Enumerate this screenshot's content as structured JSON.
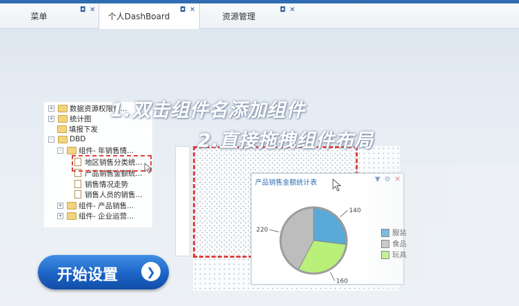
{
  "tabs": [
    {
      "label": "菜单",
      "active": false
    },
    {
      "label": "个人DashBoard",
      "active": true
    },
    {
      "label": "资源管理",
      "active": false
    }
  ],
  "tab_controls": {
    "restore": "◘",
    "close": "✕"
  },
  "tree": {
    "items": [
      {
        "label": "数据资源权限管...",
        "level": 0,
        "expander": "+"
      },
      {
        "label": "统计图",
        "level": 0,
        "expander": "+"
      },
      {
        "label": "填报下发",
        "level": 0,
        "expander": ""
      },
      {
        "label": "DBD",
        "level": 0,
        "expander": "-"
      },
      {
        "label": "组件- 年销售情...",
        "level": 1,
        "expander": "-"
      },
      {
        "label": "地区销售分类统...",
        "level": 2,
        "expander": ""
      },
      {
        "label": "产品销售金额统...",
        "level": 2,
        "expander": ""
      },
      {
        "label": "销售情况走势",
        "level": 2,
        "expander": ""
      },
      {
        "label": "销售人员的销售...",
        "level": 2,
        "expander": ""
      },
      {
        "label": "组件- 产品销售...",
        "level": 1,
        "expander": "+"
      },
      {
        "label": "组件- 企业运营...",
        "level": 1,
        "expander": "+"
      }
    ]
  },
  "instructions": {
    "step1": "1.双击组件名添加组件",
    "step2": "2.直接拖拽组件布局"
  },
  "widget": {
    "title": "产品销售金额统计表",
    "icons": [
      "filter-icon",
      "gear-icon",
      "close-icon"
    ]
  },
  "chart_data": {
    "type": "pie",
    "slices": [
      {
        "name": "服装",
        "value": 140,
        "color": "#5aa9d6"
      },
      {
        "name": "玩具",
        "value": 160,
        "color": "#b8f07a"
      },
      {
        "name": "食品",
        "value": 220,
        "color": "#bdbdbd"
      }
    ],
    "data_labels": [
      "140",
      "160",
      "220"
    ],
    "legend_position": "right",
    "legend_labels": [
      "服装",
      "食品",
      "玩具"
    ]
  },
  "start_button": {
    "label": "开始设置",
    "arrow": "❯"
  }
}
